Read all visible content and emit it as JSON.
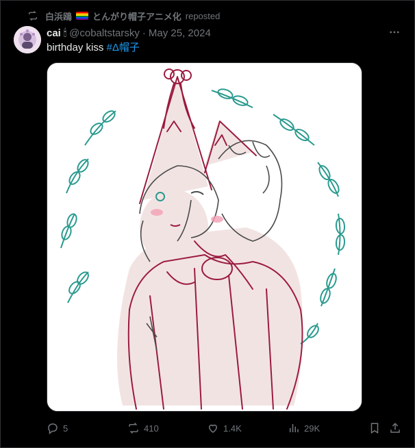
{
  "repost": {
    "reposter_name": "白浜鴎",
    "reposter_suffix": "とんがり帽子アニメ化",
    "reposted_label": "reposted"
  },
  "tweet": {
    "author_name": "cai",
    "author_emoji": "🕯",
    "handle": "@cobaltstarsky",
    "separator": "·",
    "date": "May 25, 2024",
    "text": "birthday kiss",
    "hashtag": "#Δ帽子",
    "more_label": "···"
  },
  "actions": {
    "replies": "5",
    "reposts": "410",
    "likes": "1.4K",
    "views": "29K"
  },
  "icons": {
    "repost": "repost-icon",
    "reply": "reply-icon",
    "like": "heart-icon",
    "views": "analytics-icon",
    "bookmark": "bookmark-icon",
    "share": "share-icon",
    "more": "more-icon"
  },
  "colors": {
    "background": "#000000",
    "text": "#e7e9ea",
    "muted": "#71767b",
    "link": "#1d9bf0",
    "illustration_line": "#9b1b3f",
    "illustration_leaf": "#2a9a8f",
    "illustration_fill": "#f2e3e3"
  }
}
